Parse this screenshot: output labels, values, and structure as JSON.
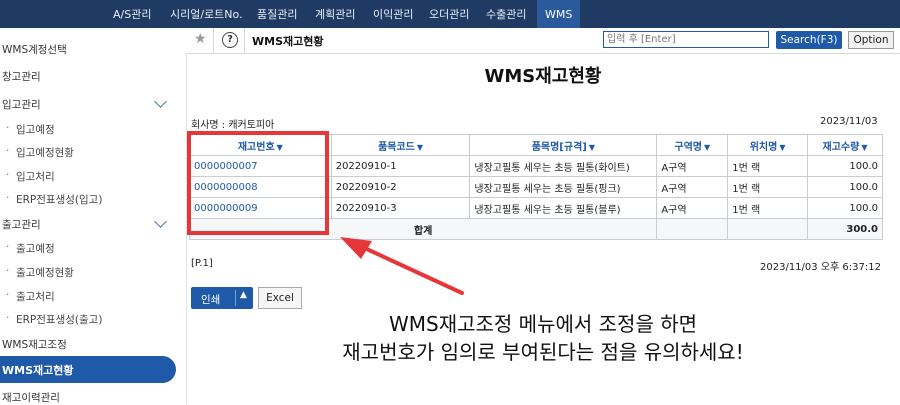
{
  "topnav": {
    "items": [
      "A/S관리",
      "시리얼/로트No.",
      "품질관리",
      "계획관리",
      "이익관리",
      "오더관리",
      "수출관리",
      "WMS"
    ]
  },
  "sidebar": {
    "items": [
      {
        "label": "WMS계정선택"
      },
      {
        "label": "창고관리"
      },
      {
        "label": "입고관리"
      },
      {
        "label": "입고예정"
      },
      {
        "label": "입고예정현황"
      },
      {
        "label": "입고처리"
      },
      {
        "label": "ERP전표생성(입고)"
      },
      {
        "label": "출고관리"
      },
      {
        "label": "출고예정"
      },
      {
        "label": "출고예정현황"
      },
      {
        "label": "출고처리"
      },
      {
        "label": "ERP전표생성(출고)"
      },
      {
        "label": "WMS재고조정"
      },
      {
        "label": "WMS재고현황"
      },
      {
        "label": "재고이력관리"
      }
    ]
  },
  "toolbar": {
    "title": "WMS재고현황",
    "search_placeholder": "입력 후 [Enter]",
    "search_label": "Search(F3)",
    "option_label": "Option"
  },
  "report": {
    "title": "WMS재고현황",
    "company": "회사명 : 캐커토피아",
    "date": "2023/11/03",
    "page": "[P.1]",
    "printed_at": "2023/11/03 오후 6:37:12"
  },
  "table": {
    "headers": [
      "재고번호",
      "품목코드",
      "품목명[규격]",
      "구역명",
      "위치명",
      "재고수량"
    ],
    "sort_icon": "▼",
    "rows": [
      [
        "0000000007",
        "20220910-1",
        "냉장고필통 세우는 초등 필통(화이트)",
        "A구역",
        "1번 랙",
        "100.0"
      ],
      [
        "0000000008",
        "20220910-2",
        "냉장고필통 세우는 초등 필통(핑크)",
        "A구역",
        "1번 랙",
        "100.0"
      ],
      [
        "0000000009",
        "20220910-3",
        "냉장고필통 세우는 초등 필통(블루)",
        "A구역",
        "1번 랙",
        "100.0"
      ]
    ],
    "total_label": "합계",
    "total_value": "300.0"
  },
  "actions": {
    "print_label": "인쇄",
    "excel_label": "Excel"
  },
  "annotation": {
    "line1": "WMS재고조정 메뉴에서 조정을 하면",
    "line2": "재고번호가 임의로 부여된다는 점을 유의하세요!",
    "color": "#e5363a"
  }
}
